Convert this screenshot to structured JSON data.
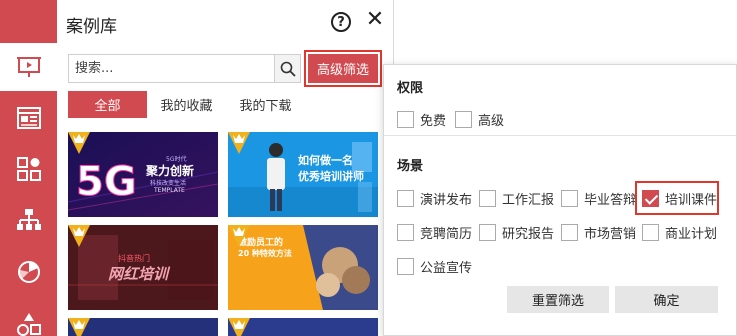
{
  "panel": {
    "title": "案例库",
    "help_icon": "?",
    "close_icon": "✕"
  },
  "search": {
    "placeholder": "搜索...",
    "button_icon": "search-icon"
  },
  "advanced_filter": {
    "label": "高级筛选"
  },
  "tabs": [
    {
      "label": "全部",
      "active": true
    },
    {
      "label": "我的收藏",
      "active": false
    },
    {
      "label": "我的下载",
      "active": false
    }
  ],
  "sidebar": {
    "items": [
      {
        "icon": "presentation-icon",
        "active": true
      },
      {
        "icon": "article-icon",
        "active": false
      },
      {
        "icon": "shapes-icon",
        "active": false
      },
      {
        "icon": "hierarchy-icon",
        "active": false
      },
      {
        "icon": "pie-chart-icon",
        "active": false
      },
      {
        "icon": "shapes-alt-icon",
        "active": false
      }
    ]
  },
  "cards": [
    {
      "name": "5G",
      "headline": "聚力创新",
      "sub": "5G时代",
      "sub2": "科技改变生活",
      "tag": "TEMPLATE"
    },
    {
      "name": "training",
      "headline": "如何做一名",
      "sub": "优秀培训讲师",
      "sub2": ""
    },
    {
      "name": "douyin",
      "headline": "网红培训",
      "sub": "抖音热门"
    },
    {
      "name": "employee",
      "headline": "激励员工的",
      "sub": "20 种特效方法"
    }
  ],
  "filter_popup": {
    "permission_label": "权限",
    "permissions": [
      {
        "label": "免费",
        "checked": false
      },
      {
        "label": "高级",
        "checked": false
      }
    ],
    "scene_label": "场景",
    "scenes": [
      {
        "label": "演讲发布",
        "checked": false
      },
      {
        "label": "工作汇报",
        "checked": false
      },
      {
        "label": "毕业答辩",
        "checked": false
      },
      {
        "label": "培训课件",
        "checked": true
      },
      {
        "label": "竞聘简历",
        "checked": false
      },
      {
        "label": "研究报告",
        "checked": false
      },
      {
        "label": "市场营销",
        "checked": false
      },
      {
        "label": "商业计划",
        "checked": false
      },
      {
        "label": "公益宣传",
        "checked": false
      }
    ],
    "reset_label": "重置筛选",
    "confirm_label": "确定"
  },
  "colors": {
    "accent": "#d04a4f",
    "highlight_border": "#e0362c"
  }
}
